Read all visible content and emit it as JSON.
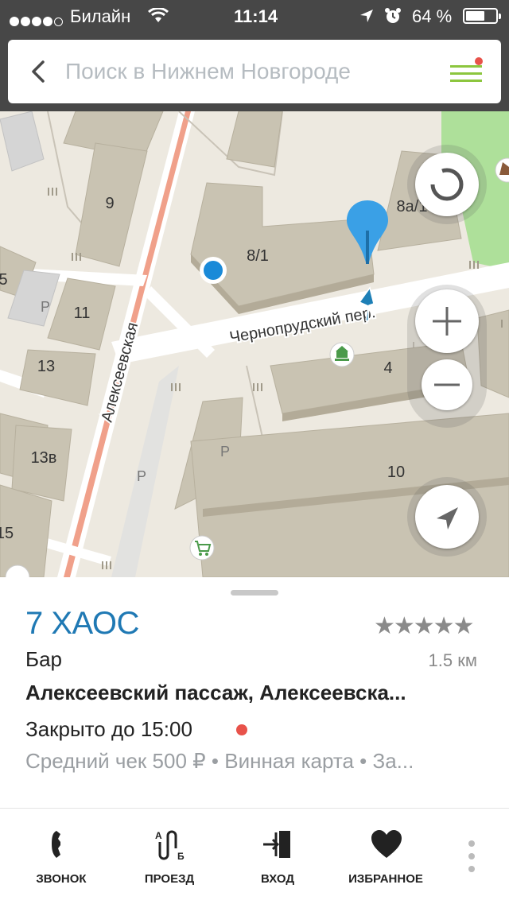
{
  "status_bar": {
    "carrier": "Билайн",
    "time": "11:14",
    "battery": "64 %",
    "battery_level": 0.64
  },
  "search": {
    "placeholder": "Поиск в Нижнем Новгороде"
  },
  "map": {
    "street_alekseevskaya": "Алексеевская",
    "street_chernoprudsky": "Чернопрудский пер.",
    "house_numbers": [
      "9",
      "8/1",
      "8а/1",
      "5",
      "11",
      "13",
      "4",
      "13в",
      "10",
      "15"
    ],
    "parking_labels": [
      "P",
      "P",
      "P"
    ]
  },
  "place": {
    "name": "7 ХАОС",
    "category": "Бар",
    "distance": "1.5 км",
    "rating_stars": "★★★★★",
    "rating": 4.5,
    "address": "Алексеевский пассаж, Алексеевска...",
    "hours": "Закрыто до 15:00",
    "features": "Средний чек 500 ₽ • Винная карта • За..."
  },
  "actions": {
    "call": "ЗВОНОК",
    "route": "ПРОЕЗД",
    "entrance": "ВХОД",
    "favorite": "ИЗБРАННОЕ"
  },
  "colors": {
    "accent_blue": "#1f79b4",
    "pin_blue": "#3aa0e6",
    "closed_red": "#e8524a",
    "menu_green": "#8cc63e",
    "status_bg": "#474747"
  }
}
